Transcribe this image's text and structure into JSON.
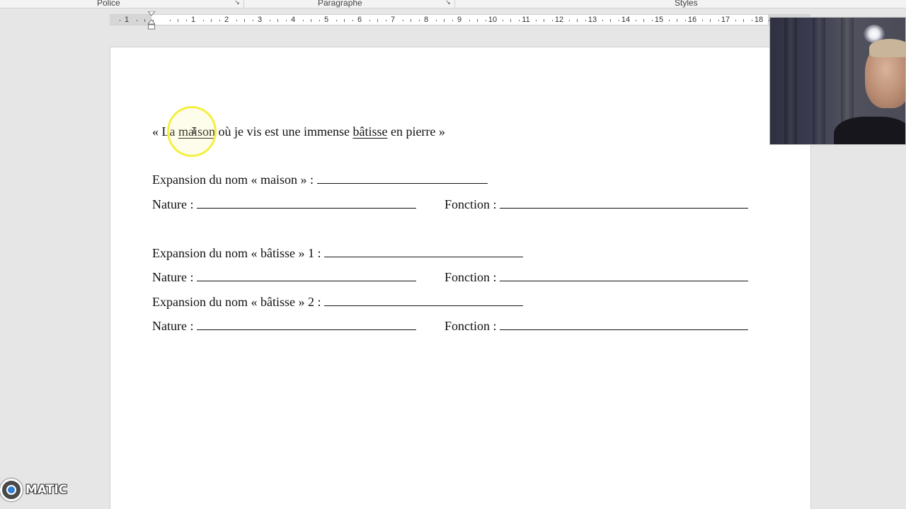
{
  "ribbon": {
    "groups": [
      {
        "label": "Police"
      },
      {
        "label": "Paragraphe"
      },
      {
        "label": "Styles"
      }
    ]
  },
  "ruler": {
    "numbers": [
      "1",
      "1",
      "2",
      "3",
      "4",
      "5",
      "6",
      "7",
      "8",
      "9",
      "10",
      "11",
      "12",
      "13",
      "14",
      "15",
      "16",
      "17",
      "18"
    ]
  },
  "document": {
    "sentence": {
      "open_quote": "« La ",
      "word1": "maison",
      "middle": " où je vis est une immense ",
      "word2": "bâtisse",
      "end": " en pierre »"
    },
    "expansion_maison": "Expansion du nom « maison » :",
    "nature_label": "Nature :",
    "fonction_label": "Fonction :",
    "expansion_batisse_1": "Expansion du nom « bâtisse » 1 :",
    "expansion_batisse_2": "Expansion du nom « bâtisse » 2 :"
  },
  "logo": {
    "text": "MATIC"
  },
  "colors": {
    "cursor_highlight": "#f4ef3e",
    "page_background": "#ffffff",
    "workspace_background": "#e6e6e6"
  }
}
